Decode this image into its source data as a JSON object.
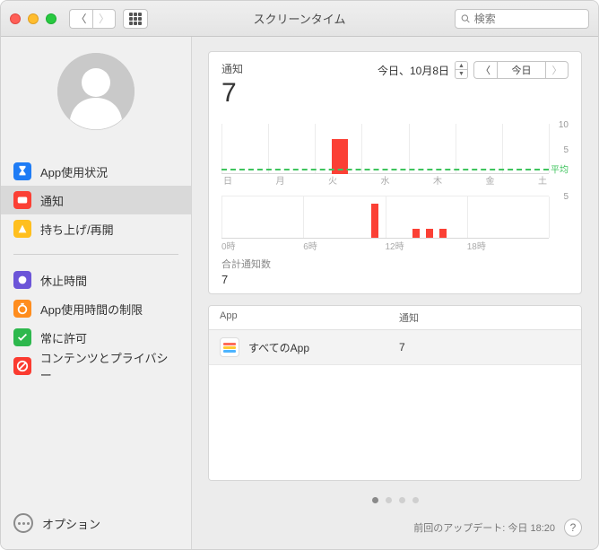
{
  "window": {
    "title": "スクリーンタイム"
  },
  "search": {
    "placeholder": "検索"
  },
  "sidebar": {
    "items": [
      {
        "label": "App使用状況",
        "color": "#1f7cf5"
      },
      {
        "label": "通知",
        "color": "#fb4035"
      },
      {
        "label": "持ち上げ/再開",
        "color": "#ffbf1f"
      }
    ],
    "items2": [
      {
        "label": "休止時間",
        "color": "#6c55d8"
      },
      {
        "label": "App使用時間の制限",
        "color": "#ff8d1e"
      },
      {
        "label": "常に許可",
        "color": "#2db84d"
      },
      {
        "label": "コンテンツとプライバシー",
        "color": "#fb3b30"
      }
    ],
    "options_label": "オプション"
  },
  "header": {
    "title": "通知",
    "big_value": "7",
    "date_label": "今日、10月8日",
    "today_label": "今日"
  },
  "chart_data": {
    "type": "bar",
    "weekly": {
      "categories": [
        "日",
        "月",
        "火",
        "水",
        "木",
        "金",
        "土"
      ],
      "values": [
        0,
        0,
        7,
        0,
        0,
        0,
        0
      ],
      "ylim": [
        0,
        10
      ],
      "avg": 1,
      "avg_label": "平均",
      "yticks": [
        5,
        10
      ]
    },
    "hourly": {
      "x_ticks": [
        "0時",
        "6時",
        "12時",
        "18時"
      ],
      "ylim": [
        0,
        5
      ],
      "yticks": [
        5
      ],
      "bars": [
        {
          "hour": 11,
          "value": 4
        },
        {
          "hour": 14,
          "value": 1
        },
        {
          "hour": 15,
          "value": 1
        },
        {
          "hour": 16,
          "value": 1
        }
      ]
    }
  },
  "totals": {
    "label": "合計通知数",
    "value": "7"
  },
  "table": {
    "columns": [
      "App",
      "通知"
    ],
    "rows": [
      {
        "app": "すべてのApp",
        "value": "7"
      }
    ]
  },
  "footer": {
    "last_update": "前回のアップデート: 今日 18:20"
  }
}
